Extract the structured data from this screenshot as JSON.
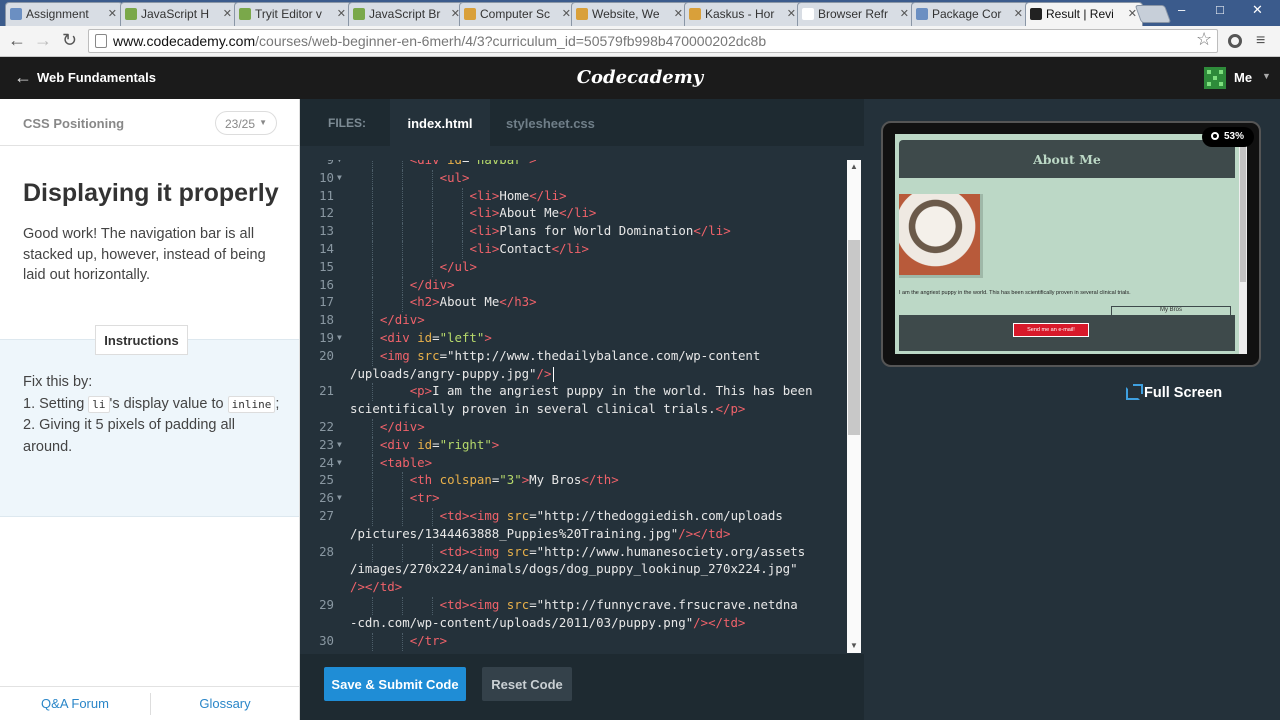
{
  "browser": {
    "tabs": [
      {
        "title": "Assignment",
        "color": "#6b8fc2"
      },
      {
        "title": "JavaScript H",
        "color": "#7aa84a"
      },
      {
        "title": "Tryit Editor v",
        "color": "#7aa84a"
      },
      {
        "title": "JavaScript Br",
        "color": "#7aa84a"
      },
      {
        "title": "Computer Sc",
        "color": "#d9a03a"
      },
      {
        "title": "Website, We",
        "color": "#d9a03a"
      },
      {
        "title": "Kaskus - Hor",
        "color": "#d9a03a"
      },
      {
        "title": "Browser Refr",
        "color": "#ffffff"
      },
      {
        "title": "Package Cor",
        "color": "#6b8fc2"
      },
      {
        "title": "Result | Revi",
        "color": "#222222"
      }
    ],
    "url_host": "www.codecademy.com",
    "url_path": "/courses/web-beginner-en-6merh/4/3?curriculum_id=50579fb998b470000202dc8b"
  },
  "header": {
    "course_title": "Web Fundamentals",
    "logo": "Codecademy",
    "user_name": "Me"
  },
  "lesson": {
    "section": "CSS Positioning",
    "progress": "23/25",
    "title": "Displaying it properly",
    "description": "Good work! The navigation bar is all stacked up, however, instead of being laid out horizontally.",
    "instructions_tab": "Instructions",
    "instr_intro": "Fix this by:",
    "instr_1a": "1. Setting ",
    "instr_1_code1": "li",
    "instr_1b": "'s display value to ",
    "instr_1_code2": "inline",
    "instr_1c": ";",
    "instr_2": "2. Giving it 5 pixels of padding all around.",
    "footer_links": [
      "Q&A Forum",
      "Glossary"
    ]
  },
  "editor": {
    "files_label": "FILES:",
    "file_tabs": [
      "index.html",
      "stylesheet.css"
    ],
    "active_file": "index.html",
    "submit_label": "Save & Submit Code",
    "reset_label": "Reset Code",
    "lines": [
      {
        "n": "9",
        "fold": true,
        "indent": 3,
        "text": "<div id=\"navbar\">"
      },
      {
        "n": "10",
        "fold": true,
        "indent": 4,
        "text": "<ul>"
      },
      {
        "n": "11",
        "fold": false,
        "indent": 5,
        "text": "<li>Home</li>"
      },
      {
        "n": "12",
        "fold": false,
        "indent": 5,
        "text": "<li>About Me</li>"
      },
      {
        "n": "13",
        "fold": false,
        "indent": 5,
        "text": "<li>Plans for World Domination</li>"
      },
      {
        "n": "14",
        "fold": false,
        "indent": 5,
        "text": "<li>Contact</li>"
      },
      {
        "n": "15",
        "fold": false,
        "indent": 4,
        "text": "</ul>"
      },
      {
        "n": "16",
        "fold": false,
        "indent": 3,
        "text": "</div>"
      },
      {
        "n": "17",
        "fold": false,
        "indent": 3,
        "text": "<h2>About Me</h3>"
      },
      {
        "n": "18",
        "fold": false,
        "indent": 2,
        "text": "</div>"
      },
      {
        "n": "19",
        "fold": true,
        "indent": 2,
        "text": "<div id=\"left\">"
      },
      {
        "n": "20",
        "fold": false,
        "indent": 2,
        "text": "<img src=\"http://www.thedailybalance.com/wp-content",
        "cont": "/uploads/angry-puppy.jpg\"/>",
        "cursor": true
      },
      {
        "n": "21",
        "fold": false,
        "indent": 2,
        "text": "    <p>I am the angriest puppy in the world. This has been",
        "cont": "scientifically proven in several clinical trials.</p>"
      },
      {
        "n": "22",
        "fold": false,
        "indent": 2,
        "text": "</div>"
      },
      {
        "n": "23",
        "fold": true,
        "indent": 2,
        "text": "<div id=\"right\">"
      },
      {
        "n": "24",
        "fold": true,
        "indent": 2,
        "text": "<table>"
      },
      {
        "n": "25",
        "fold": false,
        "indent": 3,
        "text": "<th colspan=\"3\">My Bros</th>"
      },
      {
        "n": "26",
        "fold": true,
        "indent": 3,
        "text": "<tr>"
      },
      {
        "n": "27",
        "fold": false,
        "indent": 4,
        "text": "<td><img src=\"http://thedoggiedish.com/uploads",
        "cont": "/pictures/1344463888_Puppies%20Training.jpg\"/></td>"
      },
      {
        "n": "28",
        "fold": false,
        "indent": 4,
        "text": "<td><img src=\"http://www.humanesociety.org/assets",
        "cont": "/images/270x224/animals/dogs/dog_puppy_lookinup_270x224.jpg\"",
        "cont2": "/></td>"
      },
      {
        "n": "29",
        "fold": false,
        "indent": 4,
        "text": "<td><img src=\"http://funnycrave.frsucrave.netdna",
        "cont": "-cdn.com/wp-content/uploads/2011/03/puppy.png\"/></td>"
      },
      {
        "n": "30",
        "fold": false,
        "indent": 3,
        "text": "</tr>"
      }
    ]
  },
  "result": {
    "zoom": "53%",
    "page_heading": "About Me",
    "page_text": "I am the angriest puppy in the world. This has been scientifically proven in several clinical trials.",
    "table_heading": "My Bros",
    "send_button_label": "Send me an e-mail!",
    "fullscreen_label": "Full Screen",
    "colors": {
      "background": "#bcd8c6",
      "header": "#3e4a4b",
      "button": "#d8192a"
    }
  }
}
